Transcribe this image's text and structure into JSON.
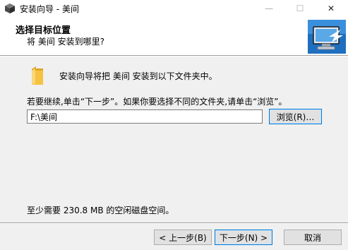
{
  "window": {
    "title": "安装向导 - 美间",
    "minimize_glyph": "—",
    "maximize_glyph": "☐",
    "close_glyph": "✕"
  },
  "header": {
    "title": "选择目标位置",
    "subtitle": "将 美间 安装到哪里?"
  },
  "main": {
    "info": "安装向导将把 美间 安装到以下文件夹中。",
    "hint": "若要继续,单击“下一步”。如果你要选择不同的文件夹,请单击“浏览”。",
    "install_path": "F:\\美间",
    "browse_label": "浏览(R)…",
    "space_required": "至少需要 230.8 MB 的空闲磁盘空间。"
  },
  "footer": {
    "back_label": "< 上一步(B)",
    "next_label": "下一步(N) >",
    "cancel_label": "取消"
  },
  "colors": {
    "accent": "#0078d7",
    "folder": "#f5c242"
  }
}
